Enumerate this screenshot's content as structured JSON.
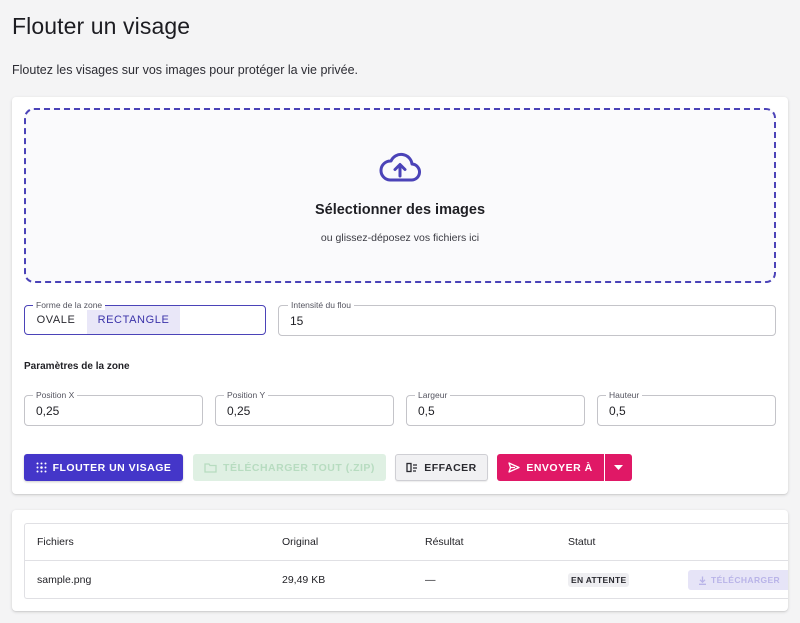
{
  "page": {
    "title": "Flouter un visage",
    "subtitle": "Floutez les visages sur vos images pour protéger la vie privée."
  },
  "dropzone": {
    "icon": "cloud-upload-icon",
    "title": "Sélectionner des images",
    "hint": "ou glissez-déposez vos fichiers ici"
  },
  "zone_shape": {
    "label": "Forme de la zone",
    "options": [
      "OVALE",
      "RECTANGLE"
    ],
    "selected": "RECTANGLE"
  },
  "blur_intensity": {
    "label": "Intensité du flou",
    "value": "15"
  },
  "zone_params": {
    "title": "Paramètres de la zone",
    "fields": [
      {
        "label": "Position X",
        "value": "0,25"
      },
      {
        "label": "Position Y",
        "value": "0,25"
      },
      {
        "label": "Largeur",
        "value": "0,5"
      },
      {
        "label": "Hauteur",
        "value": "0,5"
      }
    ]
  },
  "actions": {
    "blur": {
      "label": "FLOUTER UN VISAGE",
      "icon": "blur-icon"
    },
    "download_all": {
      "label": "TÉLÉCHARGER TOUT (.ZIP)",
      "icon": "folder-zip-icon"
    },
    "clear": {
      "label": "EFFACER",
      "icon": "clear-list-icon"
    },
    "send": {
      "label": "ENVOYER À",
      "icon": "send-icon"
    }
  },
  "files_table": {
    "columns": [
      "Fichiers",
      "Original",
      "Résultat",
      "Statut"
    ],
    "rows": [
      {
        "file": "sample.png",
        "original": "29,49 KB",
        "result": "—",
        "status": "EN ATTENTE",
        "action": "TÉLÉCHARGER"
      }
    ]
  },
  "colors": {
    "primary": "#4436c9",
    "accent": "#e01866",
    "success_disabled": "#dff0e3",
    "background": "#f4f4f5"
  }
}
